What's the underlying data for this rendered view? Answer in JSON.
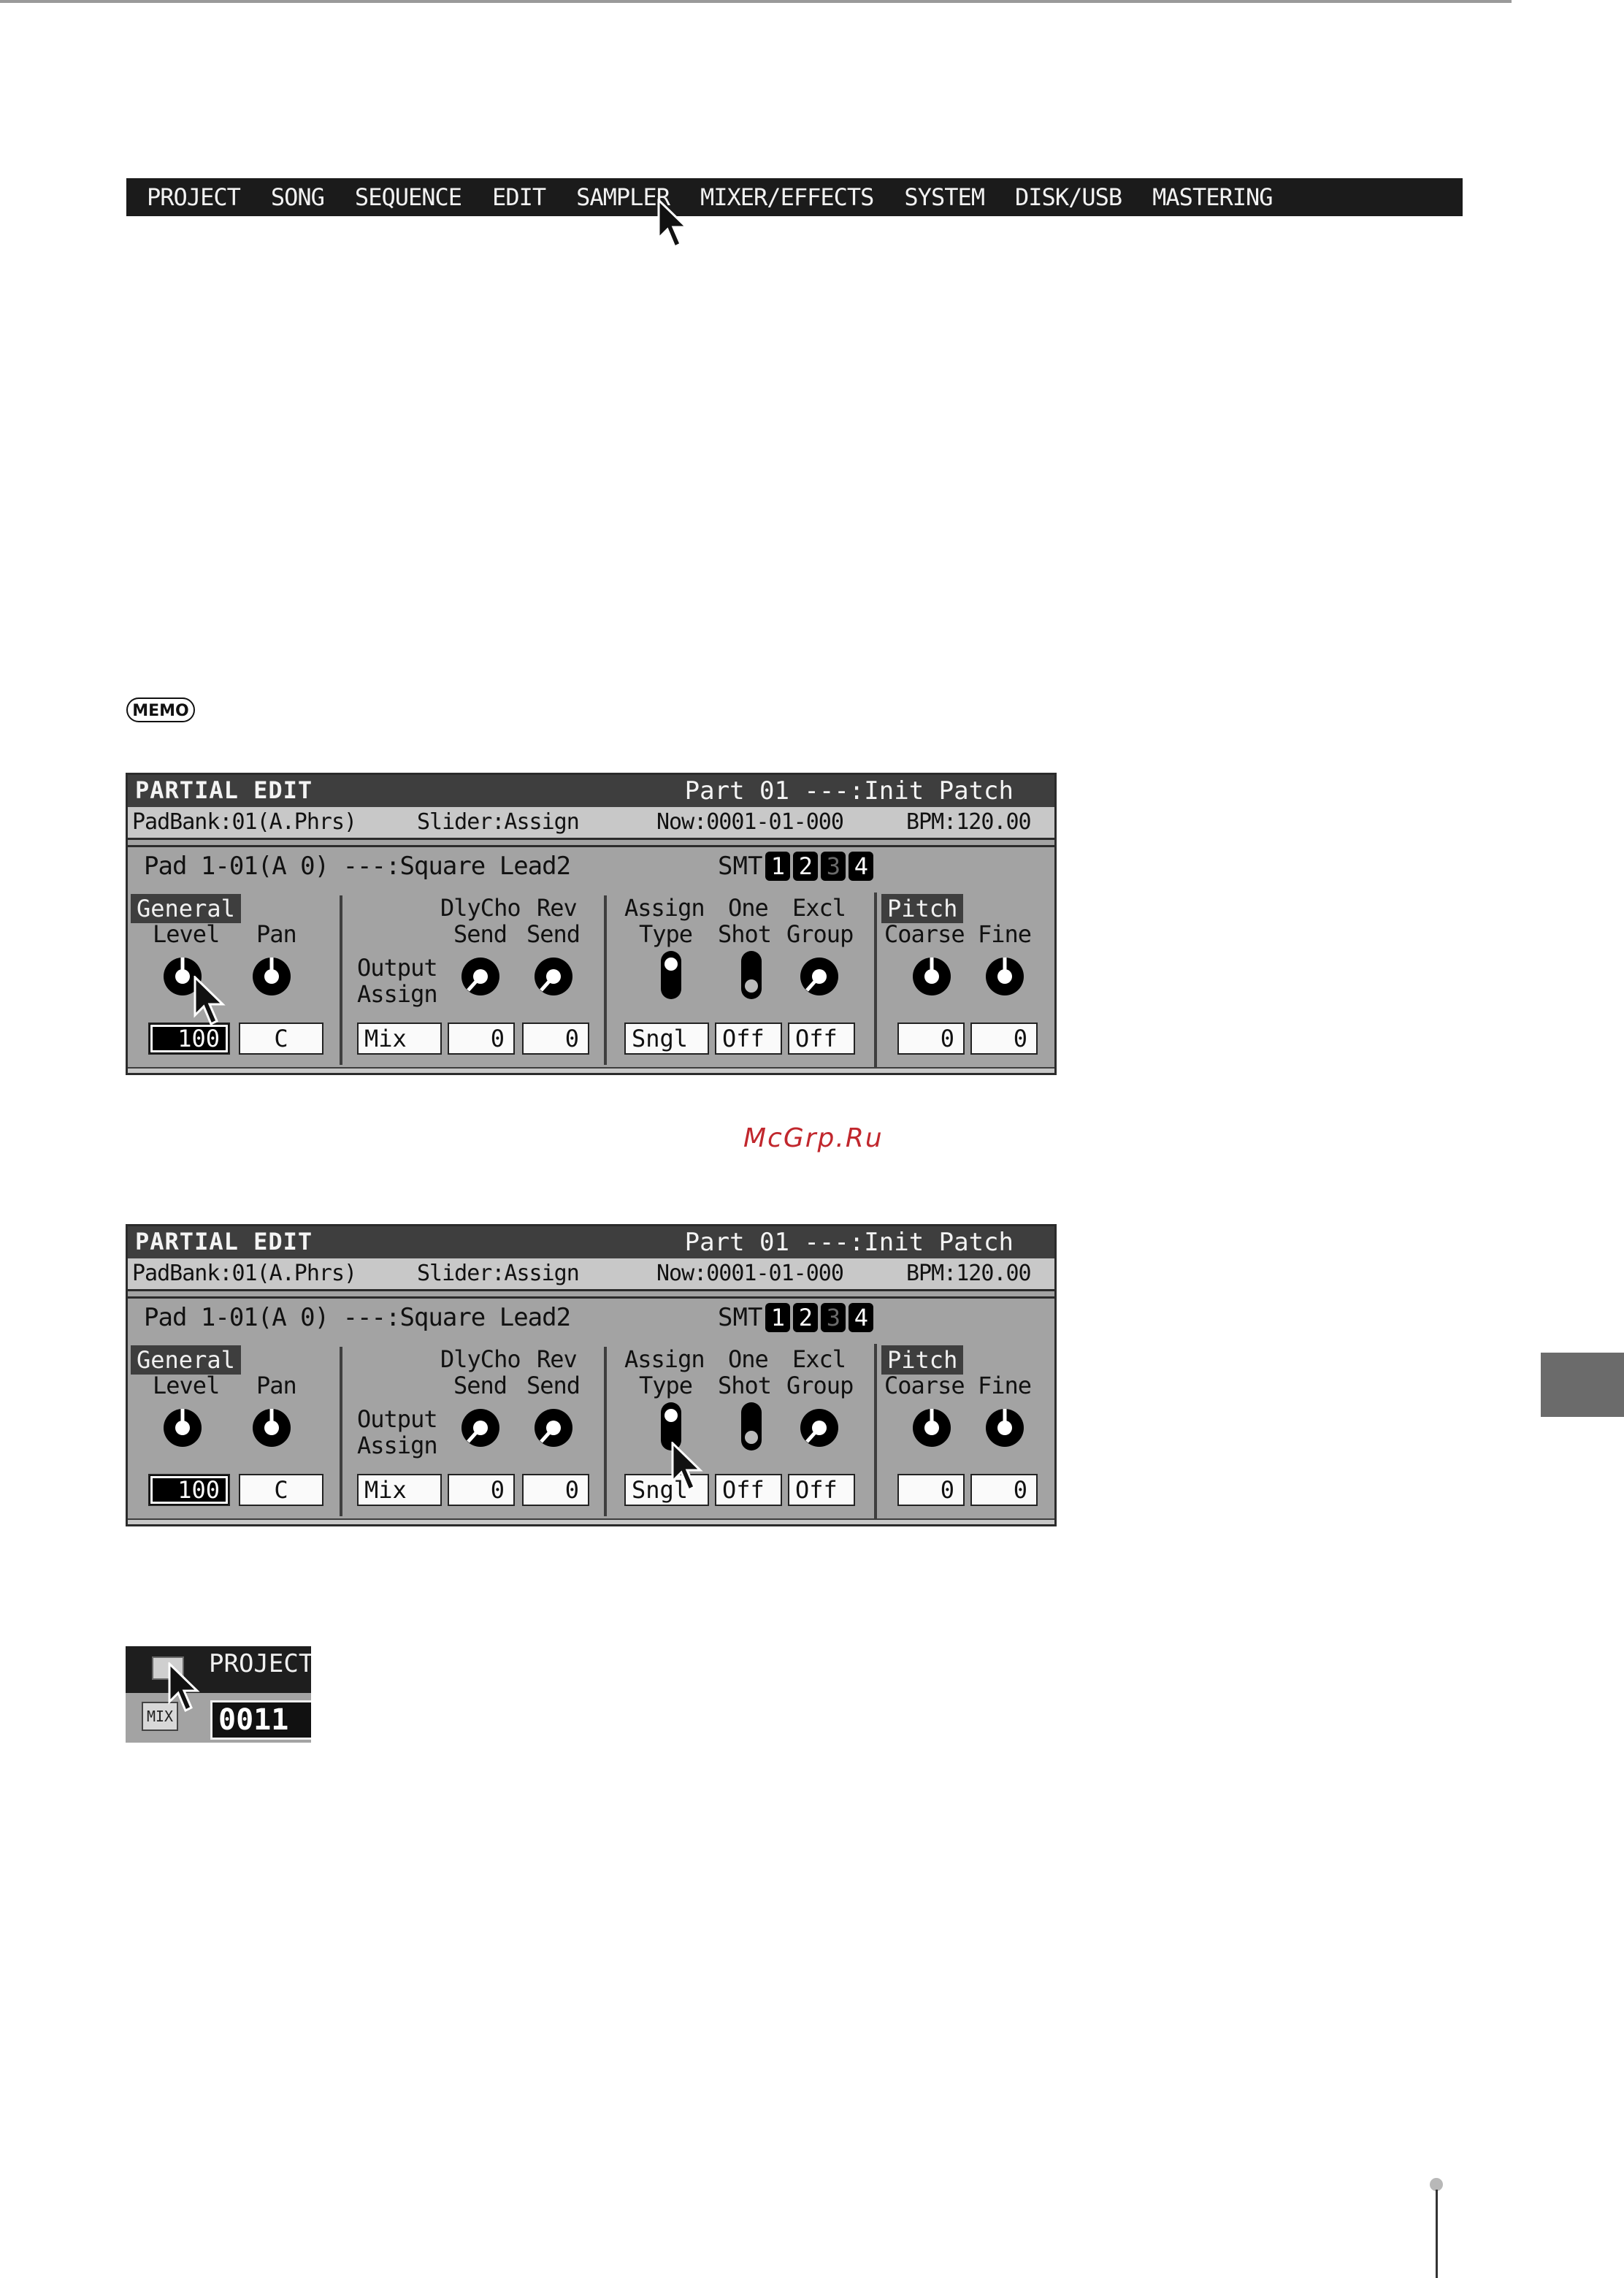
{
  "menu": {
    "items": [
      "PROJECT",
      "SONG",
      "SEQUENCE",
      "EDIT",
      "SAMPLER",
      "MIXER/EFFECTS",
      "SYSTEM",
      "DISK/USB",
      "MASTERING"
    ]
  },
  "memo_label": "MEMO",
  "watermark": "McGrp.Ru",
  "screen": {
    "title": "PARTIAL EDIT",
    "part": "Part 01 ---:Init Patch",
    "padbank": "PadBank:01(A.Phrs)",
    "slider": "Slider:Assign",
    "now": "Now:0001-01-000",
    "bpm": "BPM:120.00",
    "pad": "Pad 1-01(A 0) ---:Square Lead2",
    "smt_label": "SMT",
    "smt": [
      "1",
      "2",
      "3",
      "4"
    ],
    "general_label": "General",
    "pitch_label": "Pitch",
    "labels": {
      "level": "Level",
      "pan": "Pan",
      "dlycho": "DlyCho",
      "rev": "Rev",
      "send1": "Send",
      "send2": "Send",
      "output": "Output",
      "assign_out": "Assign",
      "assign": "Assign",
      "type": "Type",
      "one": "One",
      "shot": "Shot",
      "excl": "Excl",
      "group": "Group",
      "coarse": "Coarse",
      "fine": "Fine"
    },
    "values": {
      "level": "100",
      "pan": "C",
      "output": "Mix",
      "dlycho_send": "0",
      "rev_send": "0",
      "assign_type": "Sngl",
      "one_shot": "Off",
      "excl_group": "Off",
      "coarse": "0",
      "fine": "0"
    }
  },
  "mini": {
    "title": "PROJECT",
    "mix": "MIX",
    "number": "0011"
  }
}
